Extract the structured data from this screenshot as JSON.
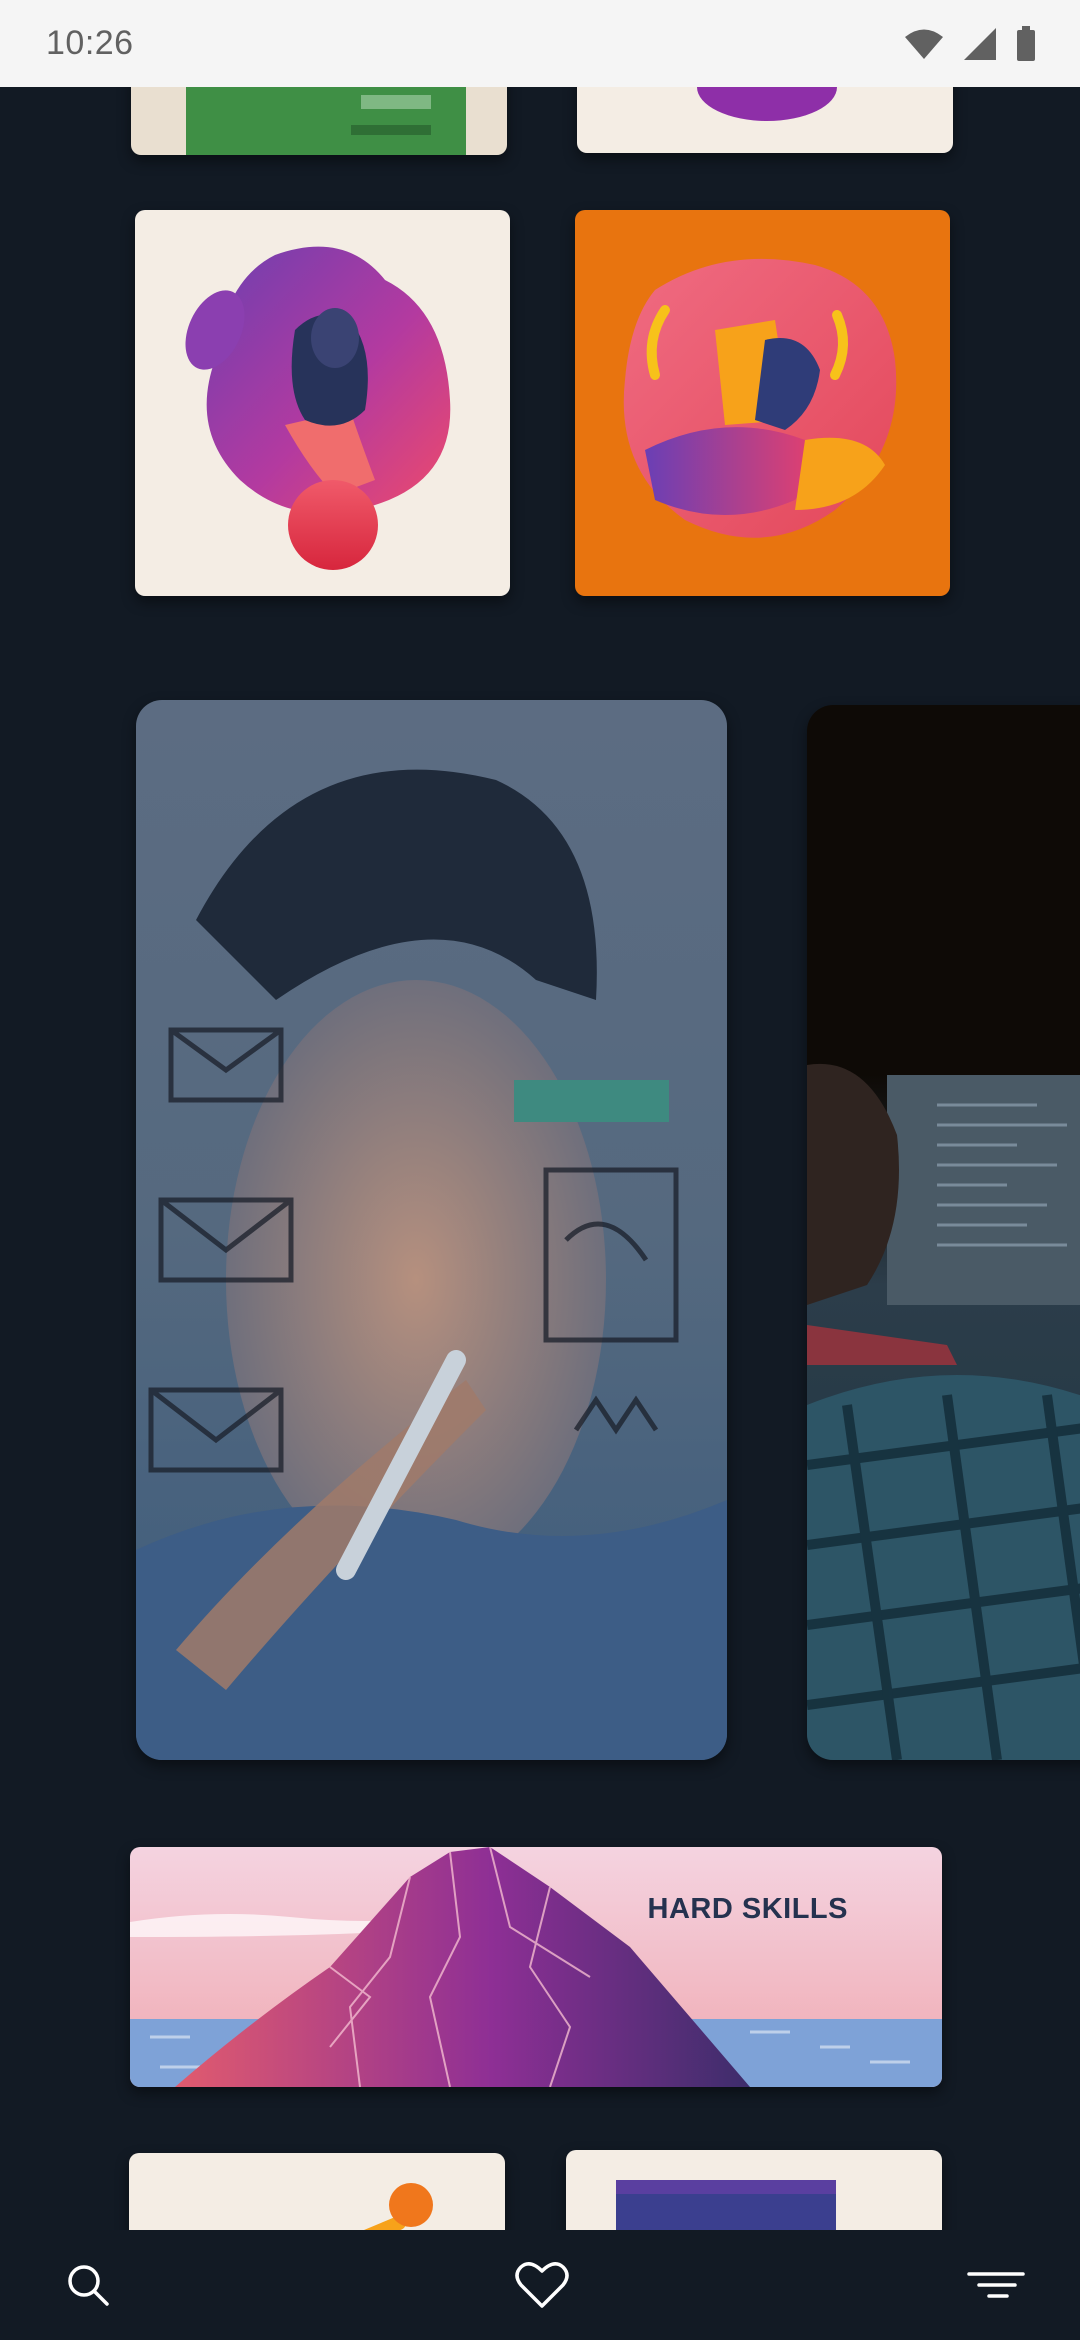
{
  "status_bar": {
    "time": "10:26",
    "icons": [
      "wifi-icon",
      "cellular-signal-icon",
      "battery-icon"
    ]
  },
  "feed": {
    "cards": [
      {
        "id": "card-top-left-partial",
        "type": "illustration"
      },
      {
        "id": "card-top-right-partial",
        "type": "illustration"
      },
      {
        "id": "card-hand-microphone",
        "type": "illustration",
        "background": "#f4ede4"
      },
      {
        "id": "card-hand-phone",
        "type": "illustration",
        "background": "#e8740f"
      },
      {
        "id": "card-whiteboard-video",
        "type": "video-thumbnail"
      },
      {
        "id": "card-coding-video",
        "type": "video-thumbnail"
      },
      {
        "id": "card-hard-skills",
        "type": "banner",
        "label": "HARD SKILLS"
      },
      {
        "id": "card-bottom-left-partial",
        "type": "illustration"
      },
      {
        "id": "card-bottom-right-partial",
        "type": "illustration"
      }
    ]
  },
  "bottom_nav": {
    "items": [
      {
        "icon": "search-icon"
      },
      {
        "icon": "heart-icon"
      },
      {
        "icon": "menu-filter-icon"
      }
    ]
  },
  "colors": {
    "background": "#121a24",
    "status_bar": "#f5f5f5",
    "accent_orange": "#e8740f",
    "accent_purple": "#7a2f9e",
    "hard_skills_text": "#25324f"
  }
}
